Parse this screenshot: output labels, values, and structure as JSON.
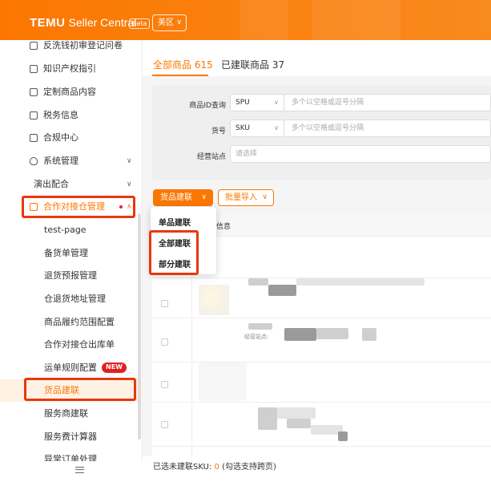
{
  "header": {
    "brand_bold": "TEMU",
    "brand_rest": "Seller Central",
    "beta": "Beta",
    "region": "美区"
  },
  "sidebar": {
    "items": [
      {
        "label": "反洗钱初审登记问卷",
        "icon": "shield-check-icon"
      },
      {
        "label": "知识产权指引",
        "icon": "document-icon"
      },
      {
        "label": "定制商品内容",
        "icon": "image-icon"
      },
      {
        "label": "税务信息",
        "icon": "percent-icon"
      },
      {
        "label": "合规中心",
        "icon": "compliance-icon"
      },
      {
        "label": "系统管理",
        "icon": "shield-icon"
      }
    ],
    "group_plain": "演出配合",
    "group_active": "合作对接仓管理",
    "sub_items": [
      "test-page",
      "备货单管理",
      "退货预报管理",
      "仓退货地址管理",
      "商品履约范围配置",
      "合作对接仓出库单",
      "运单规则配置",
      "货品建联",
      "服务商建联",
      "服务费计算器",
      "异常订单处理"
    ],
    "new_badge": "NEW",
    "selected": "货品建联"
  },
  "tabs": [
    {
      "label": "全部商品 615",
      "active": true
    },
    {
      "label": "已建联商品 37",
      "active": false
    }
  ],
  "filters": {
    "product_id_label": "商品ID查询",
    "product_id_type": "SPU",
    "product_id_placeholder": "多个以空格或逗号分隔",
    "sku_label": "货号",
    "sku_type": "SKU",
    "sku_placeholder": "多个以空格或逗号分隔",
    "site_label": "经营站点",
    "site_placeholder": "请选择"
  },
  "actions": {
    "link_button": "货品建联",
    "import_button": "批量导入"
  },
  "dropdown": {
    "items": [
      "单品建联",
      "全部建联",
      "部分建联"
    ]
  },
  "table": {
    "header_fragment": "信息",
    "row_site_label": "经营站点: "
  },
  "footer": {
    "prefix": "已选未建联SKU: ",
    "count": "0",
    "suffix": " (勾选支持跨页)"
  },
  "colors": {
    "brand": "#fb7701",
    "highlight_box": "#e8380d",
    "new_badge": "#e02020"
  }
}
